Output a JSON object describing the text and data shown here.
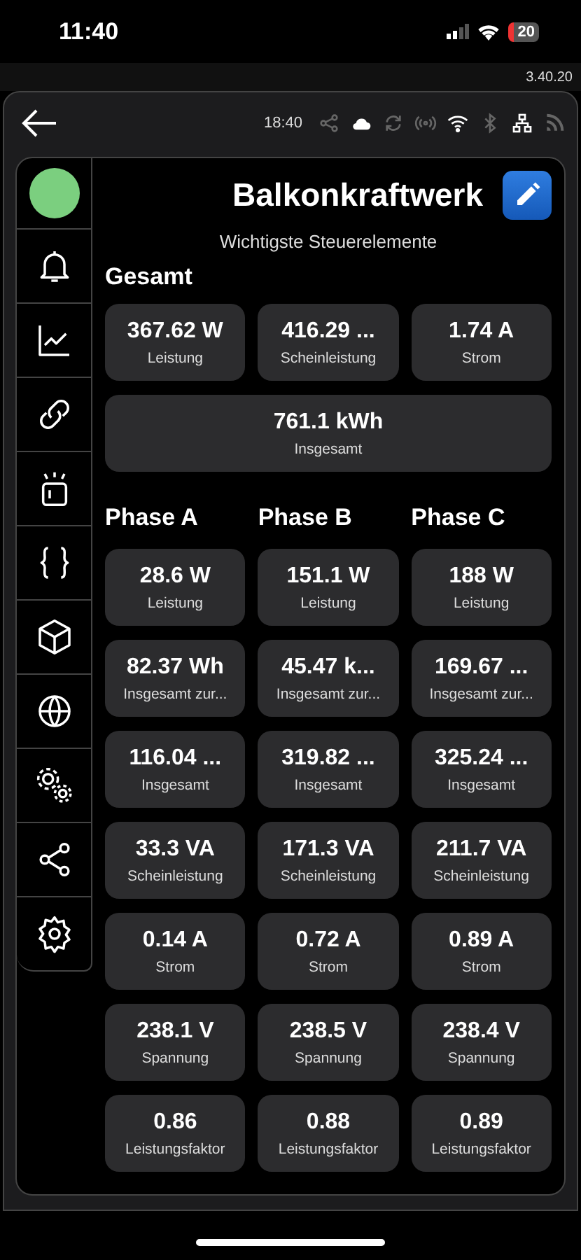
{
  "status_bar": {
    "time": "11:40",
    "battery": "20"
  },
  "version": "3.40.20",
  "toolbar": {
    "time": "18:40",
    "indicators": [
      {
        "kind": "share",
        "active": false
      },
      {
        "kind": "cloud",
        "active": true
      },
      {
        "kind": "sync",
        "active": false
      },
      {
        "kind": "broadcast",
        "active": false
      },
      {
        "kind": "wifi",
        "active": true
      },
      {
        "kind": "bluetooth",
        "active": false
      },
      {
        "kind": "network",
        "active": true
      },
      {
        "kind": "rss",
        "active": false
      }
    ]
  },
  "device": {
    "online": true,
    "title": "Balkonkraftwerk",
    "subtitle": "Wichtigste Steuerelemente"
  },
  "sidebar": {
    "items": [
      {
        "kind": "bell"
      },
      {
        "kind": "chart"
      },
      {
        "kind": "link"
      },
      {
        "kind": "light"
      },
      {
        "kind": "braces"
      },
      {
        "kind": "cube"
      },
      {
        "kind": "globe"
      },
      {
        "kind": "gears"
      },
      {
        "kind": "share"
      },
      {
        "kind": "gear"
      }
    ]
  },
  "total": {
    "heading": "Gesamt",
    "tiles": [
      {
        "value": "367.62 W",
        "label": "Leistung"
      },
      {
        "value": "416.29 ...",
        "label": "Scheinleistung"
      },
      {
        "value": "1.74 A",
        "label": "Strom"
      }
    ],
    "wide_tile": {
      "value": "761.1 kWh",
      "label": "Insgesamt"
    }
  },
  "phases": [
    {
      "heading": "Phase A",
      "tiles": [
        {
          "value": "28.6 W",
          "label": "Leistung"
        },
        {
          "value": "82.37 Wh",
          "label": "Insgesamt zur..."
        },
        {
          "value": "116.04 ...",
          "label": "Insgesamt"
        },
        {
          "value": "33.3 VA",
          "label": "Scheinleistung"
        },
        {
          "value": "0.14 A",
          "label": "Strom"
        },
        {
          "value": "238.1 V",
          "label": "Spannung"
        },
        {
          "value": "0.86",
          "label": "Leistungsfaktor"
        }
      ]
    },
    {
      "heading": "Phase B",
      "tiles": [
        {
          "value": "151.1 W",
          "label": "Leistung"
        },
        {
          "value": "45.47 k...",
          "label": "Insgesamt zur..."
        },
        {
          "value": "319.82 ...",
          "label": "Insgesamt"
        },
        {
          "value": "171.3 VA",
          "label": "Scheinleistung"
        },
        {
          "value": "0.72 A",
          "label": "Strom"
        },
        {
          "value": "238.5 V",
          "label": "Spannung"
        },
        {
          "value": "0.88",
          "label": "Leistungsfaktor"
        }
      ]
    },
    {
      "heading": "Phase C",
      "tiles": [
        {
          "value": "188 W",
          "label": "Leistung"
        },
        {
          "value": "169.67 ...",
          "label": "Insgesamt zur..."
        },
        {
          "value": "325.24 ...",
          "label": "Insgesamt"
        },
        {
          "value": "211.7 VA",
          "label": "Scheinleistung"
        },
        {
          "value": "0.89 A",
          "label": "Strom"
        },
        {
          "value": "238.4 V",
          "label": "Spannung"
        },
        {
          "value": "0.89",
          "label": "Leistungsfaktor"
        }
      ]
    }
  ]
}
